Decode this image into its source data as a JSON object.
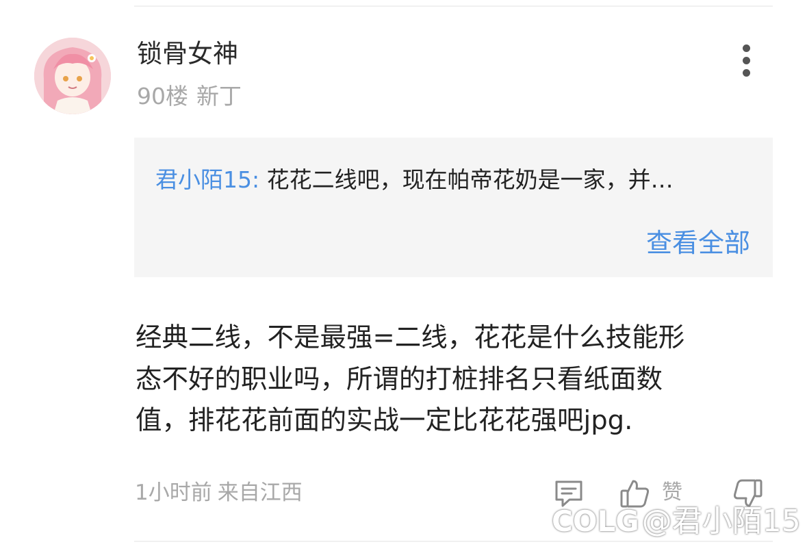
{
  "post": {
    "username": "锁骨女神",
    "floor": "90楼",
    "rank": "新丁",
    "quote": {
      "author": "君小陌15:",
      "text": "花花二线吧，现在帕帝花奶是一家，并…",
      "view_all": "查看全部"
    },
    "body_lines": [
      "经典二线，不是最强=二线，花花是什么技能形",
      "态不好的职业吗，所谓的打桩排名只看纸面数",
      "值，排花花前面的实战一定比花花强吧jpg."
    ],
    "time": "1小时前",
    "region": "来自江西",
    "like_label": "赞"
  },
  "watermark": {
    "logo": "COLG",
    "text": "@君小陌15"
  },
  "icons": {
    "reply": "comment-icon",
    "like": "thumbs-up-icon",
    "dislike": "thumbs-down-icon",
    "more": "more-vertical-icon"
  },
  "colors": {
    "link": "#4a8fe2",
    "meta": "#a8a8a8",
    "quote_bg": "#f5f5f5"
  }
}
